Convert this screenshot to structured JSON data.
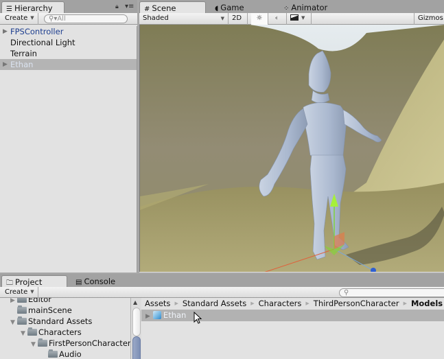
{
  "hierarchy": {
    "tab_label": "Hierarchy",
    "create_label": "Create",
    "search_placeholder": "All",
    "items": [
      {
        "label": "FPSController",
        "type": "prefab",
        "expandable": true
      },
      {
        "label": "Directional Light",
        "type": "object",
        "expandable": false
      },
      {
        "label": "Terrain",
        "type": "object",
        "expandable": false
      },
      {
        "label": "Ethan",
        "type": "prefab",
        "expandable": true,
        "selected": true
      }
    ]
  },
  "scene": {
    "tabs": [
      {
        "label": "Scene",
        "icon": "grid-icon",
        "active": true
      },
      {
        "label": "Game",
        "icon": "pacman-icon",
        "active": false
      },
      {
        "label": "Animator",
        "icon": "animator-icon",
        "active": false
      }
    ],
    "toolbar": {
      "draw_mode": "Shaded",
      "mode_2d": "2D",
      "lighting_icon": "sun-icon",
      "audio_icon": "speaker-icon",
      "effects_icon": "image-icon",
      "gizmos_label": "Gizmos"
    },
    "selected_object": "Ethan"
  },
  "project": {
    "tabs": [
      {
        "label": "Project",
        "icon": "folder-icon",
        "active": true
      },
      {
        "label": "Console",
        "icon": "console-icon",
        "active": false
      }
    ],
    "create_label": "Create",
    "tree": [
      {
        "label": "Editor",
        "depth": 1,
        "fold": "collapsed"
      },
      {
        "label": "mainScene",
        "depth": 1,
        "fold": "none"
      },
      {
        "label": "Standard Assets",
        "depth": 1,
        "fold": "expanded"
      },
      {
        "label": "Characters",
        "depth": 2,
        "fold": "expanded"
      },
      {
        "label": "FirstPersonCharacter",
        "depth": 3,
        "fold": "expanded"
      },
      {
        "label": "Audio",
        "depth": 4,
        "fold": "none"
      }
    ],
    "breadcrumb": [
      "Assets",
      "Standard Assets",
      "Characters",
      "ThirdPersonCharacter",
      "Models"
    ],
    "assets": [
      {
        "label": "Ethan",
        "icon": "prefab-cube-icon",
        "selected": true
      }
    ]
  },
  "colors": {
    "prefab_text": "#1d3e8f",
    "selection_bg": "#b4b4b4",
    "panel_bg": "#e2e2e2"
  }
}
